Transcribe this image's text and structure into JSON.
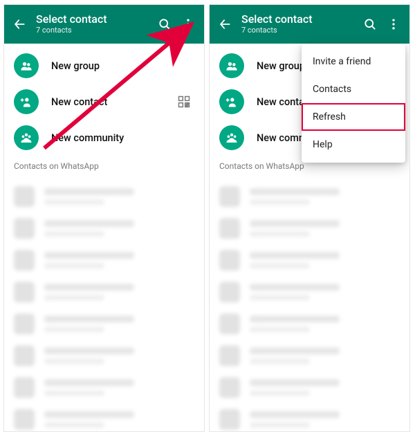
{
  "colors": {
    "brand": "#008069",
    "accent": "#00a884",
    "highlight_red": "#e2003b"
  },
  "appbar": {
    "title": "Select contact",
    "subtitle": "7 contacts"
  },
  "rows": {
    "new_group": "New group",
    "new_contact": "New contact",
    "new_community": "New community"
  },
  "section_header": "Contacts on WhatsApp",
  "menu": {
    "invite": "Invite a friend",
    "contacts": "Contacts",
    "refresh": "Refresh",
    "help": "Help"
  },
  "right_panel_truncated_row": "New commu"
}
